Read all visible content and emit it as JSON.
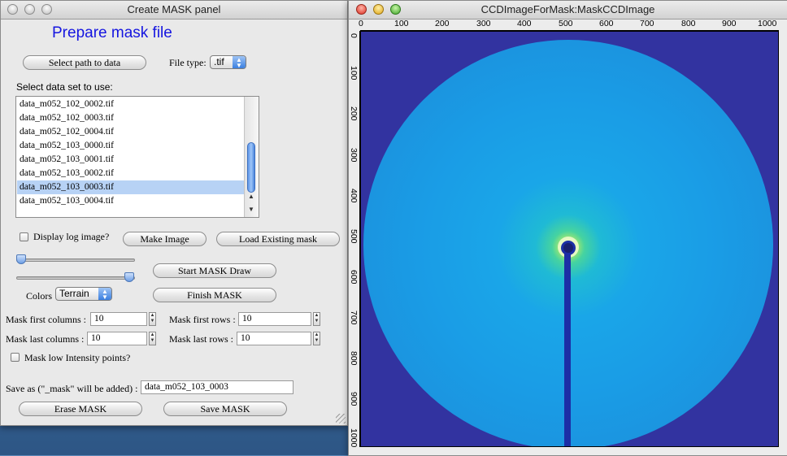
{
  "left_window": {
    "title": "Create MASK panel",
    "heading": "Prepare mask file",
    "select_path_button": "Select path to data",
    "file_type_label": "File type:",
    "file_type_value": ".tif",
    "dataset_label": "Select data set to use:",
    "files": [
      "data_m052_102_0002.tif",
      "data_m052_102_0003.tif",
      "data_m052_102_0004.tif",
      "data_m052_103_0000.tif",
      "data_m052_103_0001.tif",
      "data_m052_103_0002.tif",
      "data_m052_103_0003.tif",
      "data_m052_103_0004.tif"
    ],
    "selected_file_index": 6,
    "display_log_label": "Display log image?",
    "display_log_checked": false,
    "make_image_button": "Make Image",
    "load_mask_button": "Load Existing mask",
    "start_draw_button": "Start MASK Draw",
    "finish_mask_button": "Finish MASK",
    "colors_label": "Colors",
    "colors_value": "Terrain",
    "slider_top_level": 0.0,
    "slider_bottom_level": 1.0,
    "mask_first_columns_label": "Mask first columns :",
    "mask_first_columns_value": "10",
    "mask_first_rows_label": "Mask first rows :",
    "mask_first_rows_value": "10",
    "mask_last_columns_label": "Mask last columns :",
    "mask_last_columns_value": "10",
    "mask_last_rows_label": "Mask last rows :",
    "mask_last_rows_value": "10",
    "mask_low_label": "Mask low Intensity points?",
    "mask_low_checked": false,
    "save_as_label": "Save as (\"_mask\" will be added) :",
    "save_as_value": "data_m052_103_0003",
    "erase_mask_button": "Erase MASK",
    "save_mask_button": "Save MASK"
  },
  "right_window": {
    "title": "CCDImageForMask:MaskCCDImage",
    "x_ticks": [
      "0",
      "100",
      "200",
      "300",
      "400",
      "500",
      "600",
      "700",
      "800",
      "900",
      "1000"
    ],
    "y_ticks": [
      "0",
      "100",
      "200",
      "300",
      "400",
      "500",
      "600",
      "700",
      "800",
      "900",
      "1000"
    ],
    "colors": {
      "background": "#3233a0",
      "detector": "#1f9be6",
      "beam_center": "#c9f24a",
      "beamstop": "#1c2ea6"
    }
  }
}
